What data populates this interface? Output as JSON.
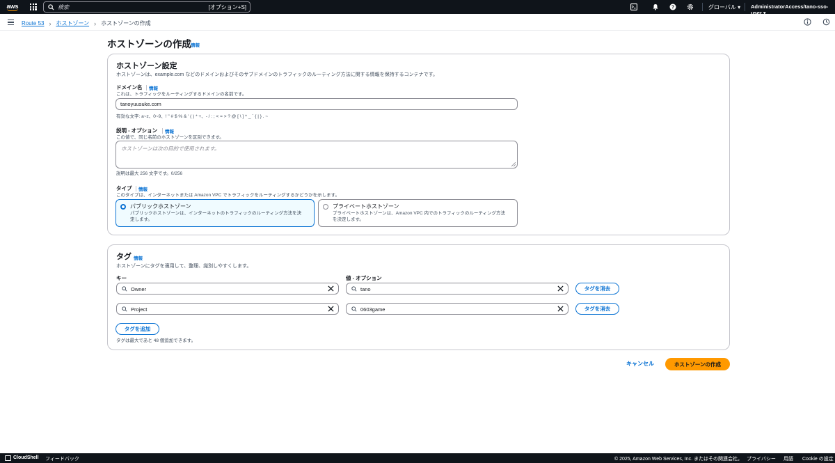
{
  "topnav": {
    "logo_text": "aws",
    "search_placeholder": "検索",
    "search_shortcut": "[オプション+S]",
    "region": "グローバル ▾",
    "account": "AdministratorAccess/tano-sso-user ▾"
  },
  "breadcrumb": {
    "items": [
      "Route 53",
      "ホストゾーン"
    ],
    "current": "ホストゾーンの作成"
  },
  "page": {
    "title": "ホストゾーンの作成",
    "info": "情報"
  },
  "settings": {
    "title": "ホストゾーン設定",
    "description": "ホストゾーンは、example.com などのドメインおよびそのサブドメインのトラフィックのルーティング方法に関する情報を保持するコンテナです。",
    "domain": {
      "label": "ドメイン名",
      "info": "情報",
      "sub": "これは、トラフィックをルーティングするドメインの名前です。",
      "value": "tanoyuusuke.com",
      "constraint": "有効な文字: a~z、0~9、! \" # $ % & ' ( ) * +、- / : ; < = > ? @ [ \\ ] ^ _ ` { | } . ~"
    },
    "description_field": {
      "label": "説明 - オプション",
      "info": "情報",
      "sub": "この値で、同じ名前のホストゾーンを区別できます。",
      "placeholder": "ホストゾーンは次の目的で使用されます。",
      "constraint": "説明は最大 256 文字です。0/256"
    },
    "type": {
      "label": "タイプ",
      "info": "情報",
      "sub": "このタイプは、インターネットまたは Amazon VPC でトラフィックをルーティングするかどうかを示します。",
      "options": [
        {
          "title": "パブリックホストゾーン",
          "desc1": "パブリックホストゾーンは、インターネットのトラフィックのルーティング方法を決",
          "desc2": "定します。",
          "selected": true
        },
        {
          "title": "プライベートホストゾーン",
          "desc1": "プライベートホストゾーンは、Amazon VPC 内でのトラフィックのルーティング方法",
          "desc2": "を決定します。",
          "selected": false
        }
      ]
    }
  },
  "tags": {
    "title": "タグ",
    "info": "情報",
    "description": "ホストゾーンにタグを適用して、整理、識別しやすくします。",
    "key_header": "キー",
    "value_header": "値 - オプション",
    "rows": [
      {
        "key": "Owner",
        "value": "tano",
        "remove": "タグを消去"
      },
      {
        "key": "Project",
        "value": "0603game",
        "remove": "タグを消去"
      }
    ],
    "add_button": "タグを追加",
    "limit": "タグは最大であと 48 個追加できます。"
  },
  "actions": {
    "cancel": "キャンセル",
    "create": "ホストゾーンの作成"
  },
  "footer": {
    "cloudshell": "CloudShell",
    "feedback": "フィードバック",
    "copyright": "© 2025, Amazon Web Services, Inc. またはその関連会社。",
    "privacy": "プライバシー",
    "terms": "用語",
    "cookie": "Cookie の設定"
  },
  "colors": {
    "nav_bg": "#0f141a",
    "link": "#0972d3",
    "primary": "#ff9900",
    "border": "#c6c6cd"
  }
}
